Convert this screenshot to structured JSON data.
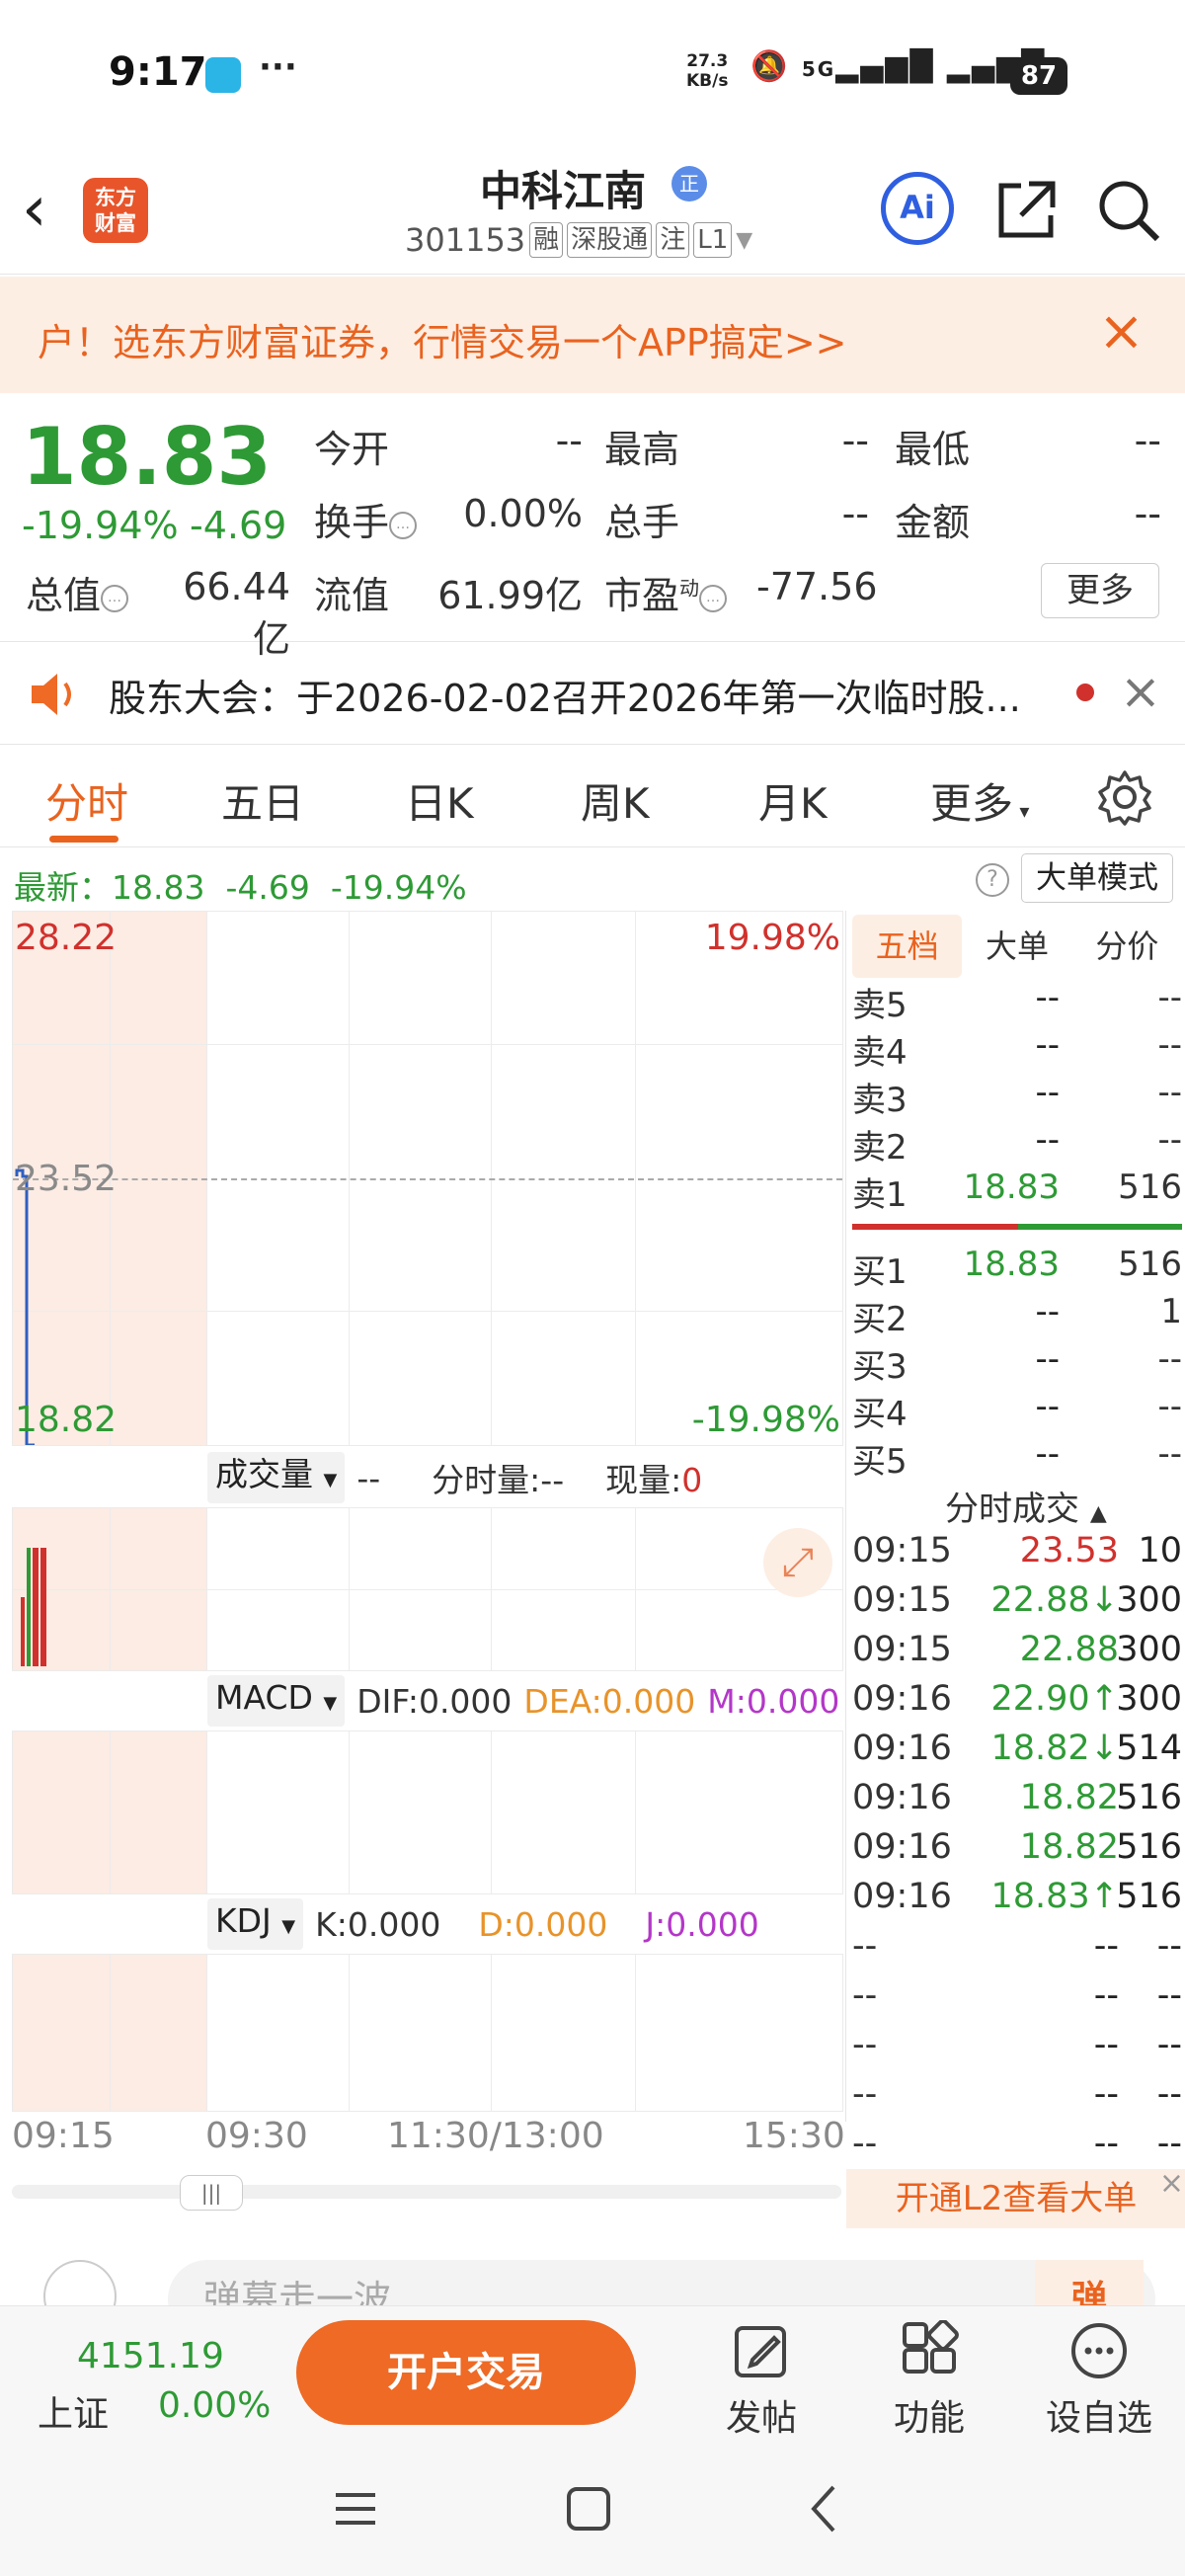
{
  "status": {
    "time": "9:17",
    "more": "···",
    "net_speed": "27.3",
    "net_unit": "KB/s",
    "signal": "5G",
    "battery": "87"
  },
  "header": {
    "logo_line1": "东方",
    "logo_line2": "财富",
    "name": "中科江南",
    "name_badge": "正",
    "code": "301153",
    "tags": [
      "融",
      "深股通",
      "注",
      "L1"
    ],
    "ai_label": "Ai"
  },
  "ad": {
    "text": "户！选东方财富证券，行情交易一个APP搞定>>"
  },
  "quote": {
    "price": "18.83",
    "change_pct": "-19.94%",
    "change": "-4.69",
    "open_label": "今开",
    "open": "--",
    "high_label": "最高",
    "high": "--",
    "low_label": "最低",
    "low": "--",
    "turnover_label": "换手",
    "turnover": "0.00%",
    "volume_label": "总手",
    "volume": "--",
    "amount_label": "金额",
    "amount": "--",
    "mktcap_label": "总值",
    "mktcap": "66.44亿",
    "float_label": "流值",
    "float": "61.99亿",
    "pe_label": "市盈",
    "pe_sup": "动",
    "pe": "-77.56",
    "more": "更多"
  },
  "notice": {
    "text": "股东大会：于2026-02-02召开2026年第一次临时股..."
  },
  "tabs": [
    "分时",
    "五日",
    "日K",
    "周K",
    "月K",
    "更多"
  ],
  "latest": {
    "label": "最新：",
    "price": "18.83",
    "change": "-4.69",
    "pct": "-19.94%",
    "help": "?",
    "mode": "大单模式"
  },
  "chart": {
    "y_top": "28.22",
    "y_mid": "23.52",
    "y_bot": "18.82",
    "pct_top": "19.98%",
    "pct_bot": "-19.98%",
    "vol_selector": "成交量",
    "vol_val": "--",
    "tick_label": "分时量:",
    "tick_val": "--",
    "now_label": "现量:",
    "now_val": "0",
    "macd_selector": "MACD",
    "dif": "DIF:0.000",
    "dea": "DEA:0.000",
    "m": "M:0.000",
    "kdj_selector": "KDJ",
    "k": "K:0.000",
    "d": "D:0.000",
    "j": "J:0.000",
    "times": [
      "09:15",
      "09:30",
      "11:30/13:00",
      "15:30"
    ],
    "scroll_thumb": "|||"
  },
  "book": {
    "tabs": [
      "五档",
      "大单",
      "分价"
    ],
    "asks": [
      {
        "label": "卖5",
        "price": "--",
        "vol": "--"
      },
      {
        "label": "卖4",
        "price": "--",
        "vol": "--"
      },
      {
        "label": "卖3",
        "price": "--",
        "vol": "--"
      },
      {
        "label": "卖2",
        "price": "--",
        "vol": "--"
      },
      {
        "label": "卖1",
        "price": "18.83",
        "vol": "516"
      }
    ],
    "bids": [
      {
        "label": "买1",
        "price": "18.83",
        "vol": "516"
      },
      {
        "label": "买2",
        "price": "--",
        "vol": "1"
      },
      {
        "label": "买3",
        "price": "--",
        "vol": "--"
      },
      {
        "label": "买4",
        "price": "--",
        "vol": "--"
      },
      {
        "label": "买5",
        "price": "--",
        "vol": "--"
      }
    ],
    "trades_header": "分时成交",
    "trades": [
      {
        "time": "09:15",
        "price": "23.53",
        "vol": "10"
      },
      {
        "time": "09:15",
        "price": "22.88↓",
        "vol": "300"
      },
      {
        "time": "09:15",
        "price": "22.88",
        "vol": "300"
      },
      {
        "time": "09:16",
        "price": "22.90↑",
        "vol": "300"
      },
      {
        "time": "09:16",
        "price": "18.82↓",
        "vol": "514"
      },
      {
        "time": "09:16",
        "price": "18.82",
        "vol": "516"
      },
      {
        "time": "09:16",
        "price": "18.82",
        "vol": "516"
      },
      {
        "time": "09:16",
        "price": "18.83↑",
        "vol": "516"
      },
      {
        "time": "--",
        "price": "--",
        "vol": "--"
      },
      {
        "time": "--",
        "price": "--",
        "vol": "--"
      },
      {
        "time": "--",
        "price": "--",
        "vol": "--"
      },
      {
        "time": "--",
        "price": "--",
        "vol": "--"
      },
      {
        "time": "--",
        "price": "--",
        "vol": "--"
      }
    ],
    "l2_text": "开通L2查看大单"
  },
  "comment": {
    "placeholder": "弹幕走一波",
    "dan": "弹"
  },
  "bottom": {
    "index_value": "4151.19",
    "index_name": "上证",
    "index_change": "0.00%",
    "trade": "开户交易",
    "post": "发帖",
    "func": "功能",
    "watch": "设自选"
  },
  "colors": {
    "up": "#d0312d",
    "down": "#2e9a35",
    "accent": "#ee6a25"
  }
}
